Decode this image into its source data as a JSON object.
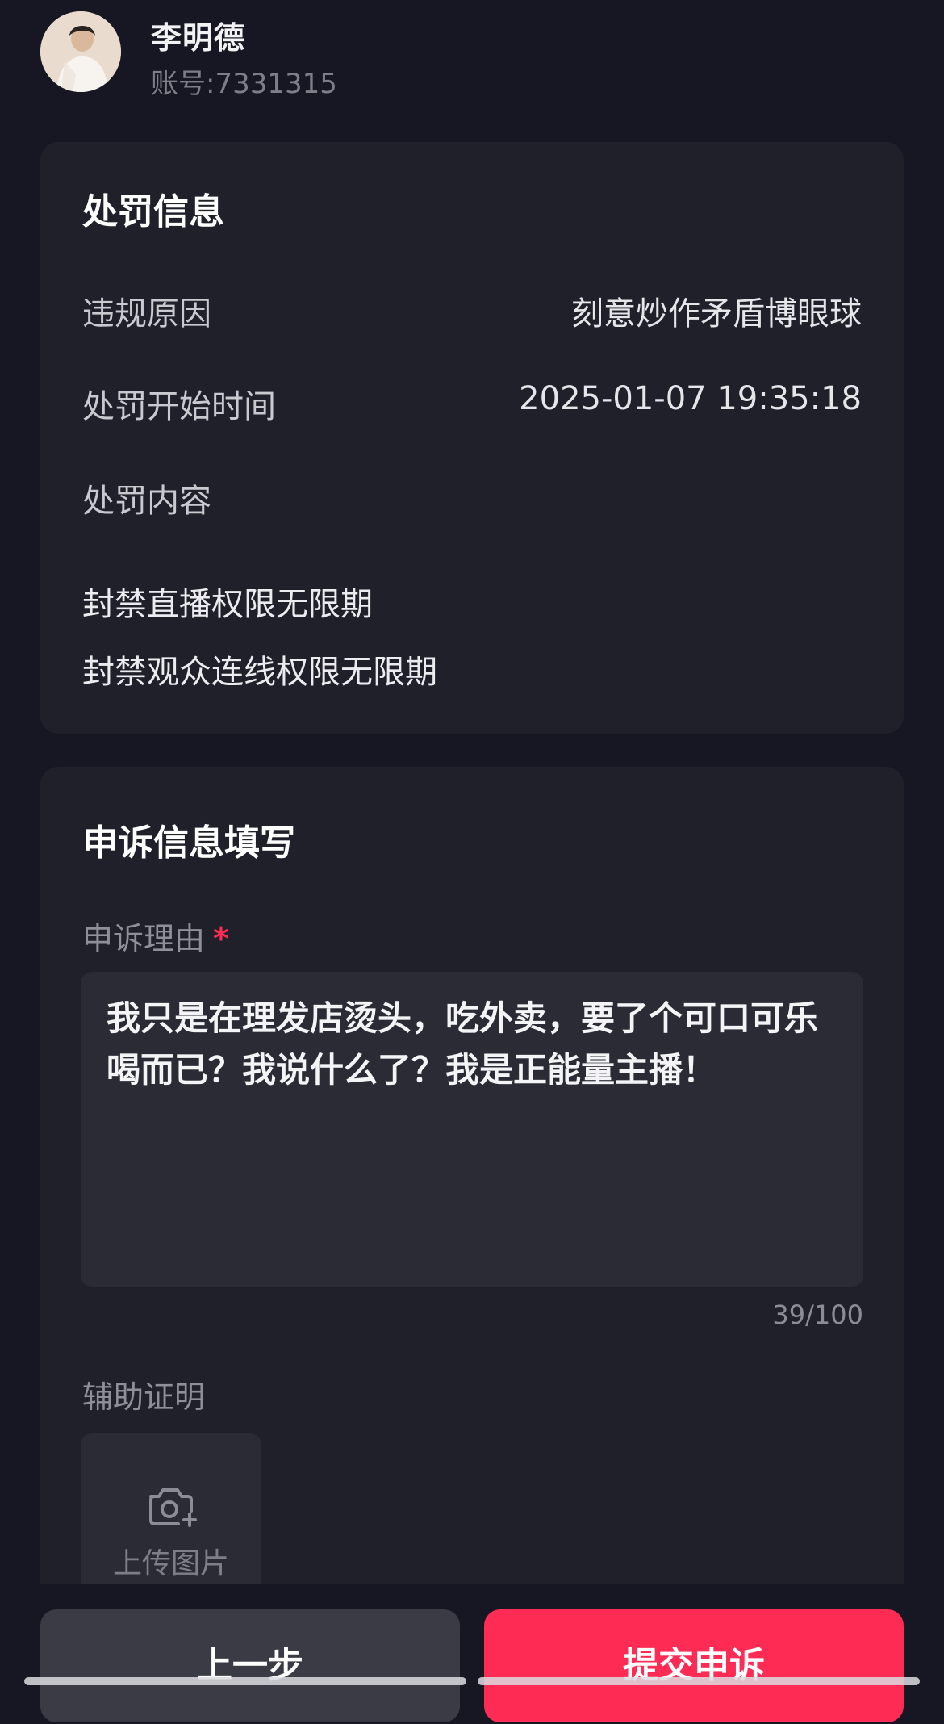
{
  "user": {
    "name": "李明德",
    "account": "账号:7331315"
  },
  "penalty": {
    "title": "处罚信息",
    "reason_label": "违规原因",
    "reason_value": "刻意炒作矛盾博眼球",
    "start_time_label": "处罚开始时间",
    "start_time_value": "2025-01-07 19:35:18",
    "content_label": "处罚内容",
    "items": [
      "封禁直播权限无限期",
      "封禁观众连线权限无限期"
    ]
  },
  "appeal": {
    "title": "申诉信息填写",
    "reason_label": "申诉理由",
    "required_mark": "*",
    "reason_text": "我只是在理发店烫头，吃外卖，要了个可口可乐喝而已？我说什么了？我是正能量主播！",
    "char_count": "39/100",
    "proof_label": "辅助证明",
    "upload_label": "上传图片",
    "upload_icon": "camera-plus-icon"
  },
  "actions": {
    "prev_label": "上一步",
    "submit_label": "提交申诉"
  },
  "colors": {
    "background": "#161722",
    "card": "#1f2029",
    "input": "#2a2b35",
    "accent": "#fe2c55",
    "secondary_button": "#3a3b45"
  }
}
